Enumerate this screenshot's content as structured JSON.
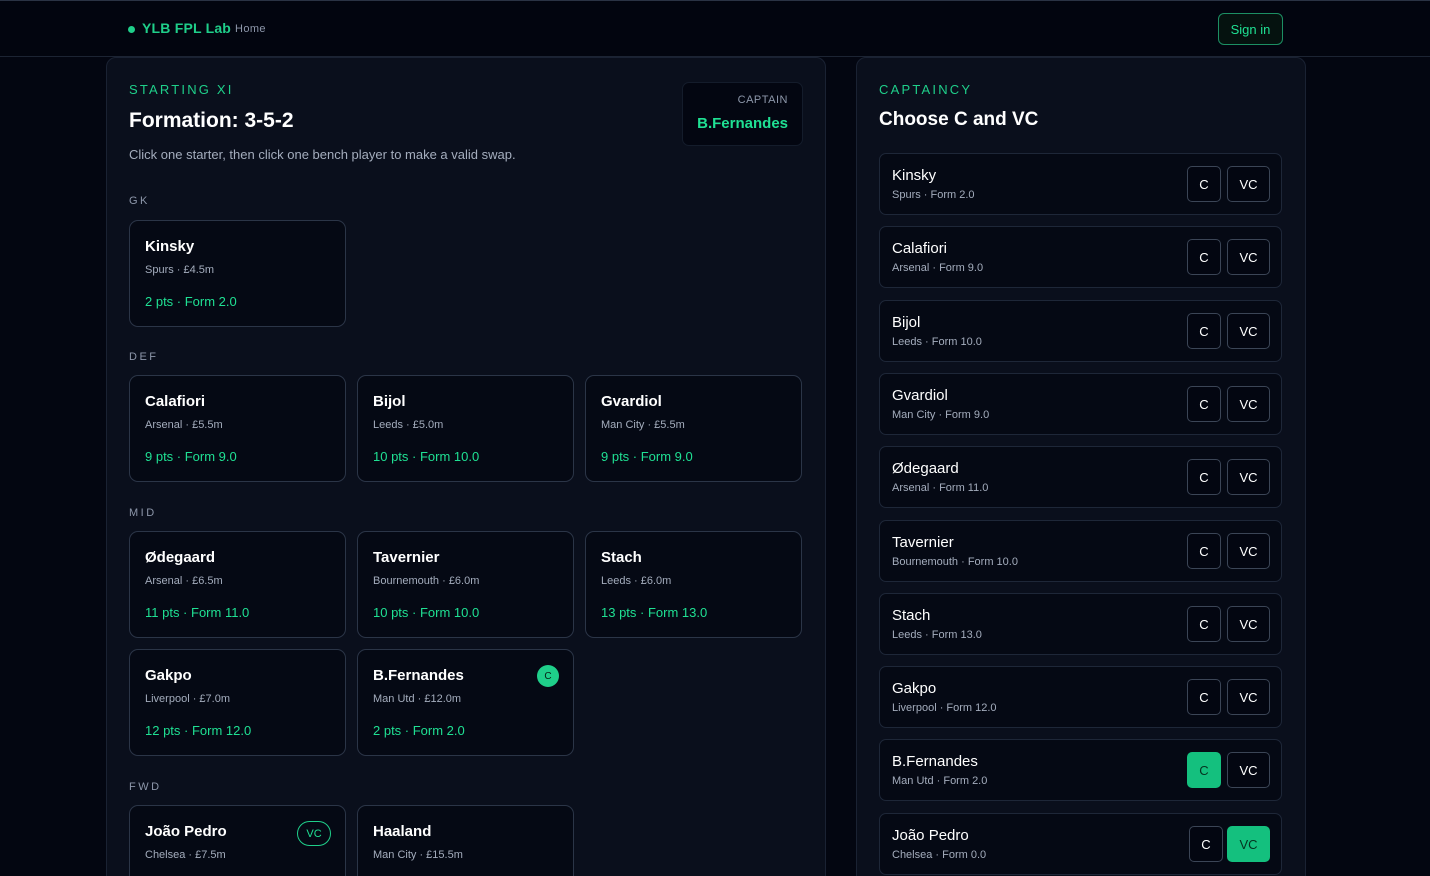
{
  "nav": {
    "brand": "YLB FPL Lab",
    "home": "Home",
    "signin": "Sign in"
  },
  "lineup": {
    "eyebrow": "STARTING XI",
    "title": "Formation: 3-5-2",
    "hint": "Click one starter, then click one bench player to make a valid swap.",
    "captain_label": "CAPTAIN",
    "captain_name": "B.Fernandes",
    "positions": {
      "gk": "GK",
      "def": "DEF",
      "mid": "MID",
      "fwd": "FWD"
    },
    "players": [
      {
        "name": "Kinsky",
        "meta": "Spurs · £4.5m",
        "pts": "2 pts · Form 2.0"
      },
      {
        "name": "Calafiori",
        "meta": "Arsenal · £5.5m",
        "pts": "9 pts · Form 9.0"
      },
      {
        "name": "Bijol",
        "meta": "Leeds · £5.0m",
        "pts": "10 pts · Form 10.0"
      },
      {
        "name": "Gvardiol",
        "meta": "Man City · £5.5m",
        "pts": "9 pts · Form 9.0"
      },
      {
        "name": "Ødegaard",
        "meta": "Arsenal · £6.5m",
        "pts": "11 pts · Form 11.0"
      },
      {
        "name": "Tavernier",
        "meta": "Bournemouth · £6.0m",
        "pts": "10 pts · Form 10.0"
      },
      {
        "name": "Stach",
        "meta": "Leeds · £6.0m",
        "pts": "13 pts · Form 13.0"
      },
      {
        "name": "Gakpo",
        "meta": "Liverpool · £7.0m",
        "pts": "12 pts · Form 12.0"
      },
      {
        "name": "B.Fernandes",
        "meta": "Man Utd · £12.0m",
        "pts": "2 pts · Form 2.0",
        "badge": "C"
      },
      {
        "name": "João Pedro",
        "meta": "Chelsea · £7.5m",
        "badge": "VC"
      },
      {
        "name": "Haaland",
        "meta": "Man City · £15.5m"
      }
    ]
  },
  "captaincy": {
    "eyebrow": "CAPTAINCY",
    "title": "Choose C and VC",
    "c_label": "C",
    "vc_label": "VC",
    "rows": [
      {
        "name": "Kinsky",
        "meta": "Spurs · Form 2.0",
        "c": false,
        "vc": false
      },
      {
        "name": "Calafiori",
        "meta": "Arsenal · Form 9.0",
        "c": false,
        "vc": false
      },
      {
        "name": "Bijol",
        "meta": "Leeds · Form 10.0",
        "c": false,
        "vc": false
      },
      {
        "name": "Gvardiol",
        "meta": "Man City · Form 9.0",
        "c": false,
        "vc": false
      },
      {
        "name": "Ødegaard",
        "meta": "Arsenal · Form 11.0",
        "c": false,
        "vc": false
      },
      {
        "name": "Tavernier",
        "meta": "Bournemouth · Form 10.0",
        "c": false,
        "vc": false
      },
      {
        "name": "Stach",
        "meta": "Leeds · Form 13.0",
        "c": false,
        "vc": false
      },
      {
        "name": "Gakpo",
        "meta": "Liverpool · Form 12.0",
        "c": false,
        "vc": false
      },
      {
        "name": "B.Fernandes",
        "meta": "Man Utd · Form 2.0",
        "c": true,
        "vc": false
      },
      {
        "name": "João Pedro",
        "meta": "Chelsea · Form 0.0",
        "c": false,
        "vc": true
      }
    ]
  },
  "colors": {
    "accent": "#1fcf8a",
    "background": "#030611",
    "panel": "#0a0f1c"
  }
}
